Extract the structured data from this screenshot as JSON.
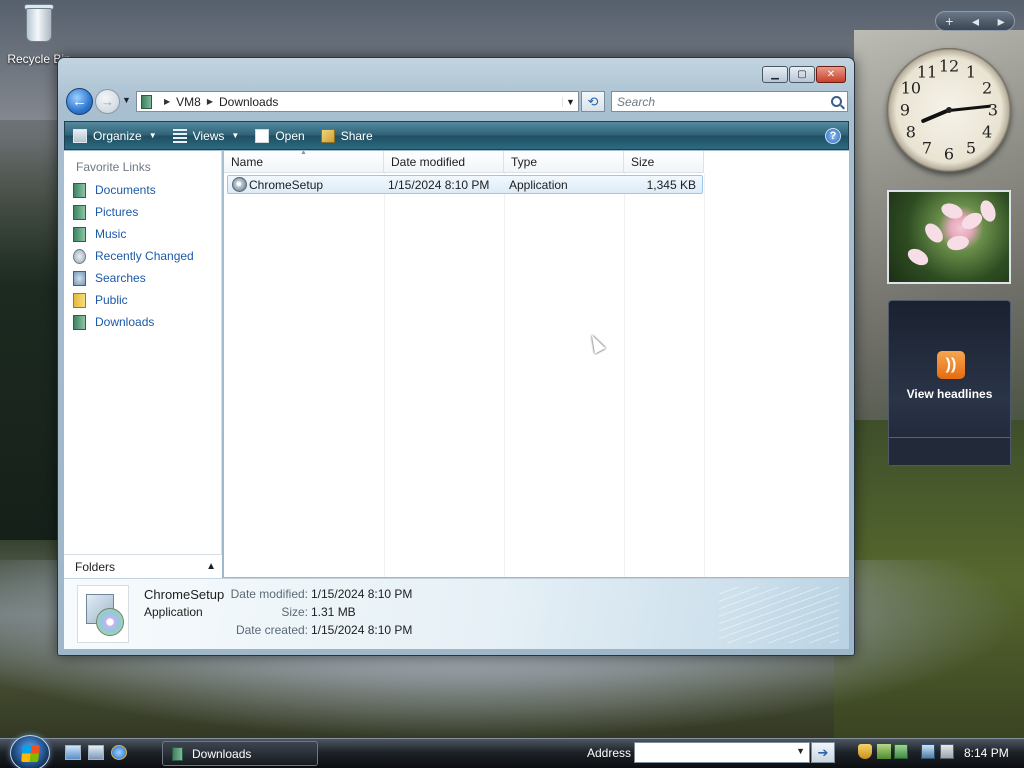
{
  "desktop": {
    "icons": [
      {
        "label": "Recycle Bin",
        "icon": "recycle-bin-icon"
      }
    ],
    "gadgets": {
      "controls": {
        "add": "+",
        "prev": "◂",
        "next": "▸"
      },
      "clock_numbers": [
        "12",
        "1",
        "2",
        "3",
        "4",
        "5",
        "6",
        "7",
        "8",
        "9",
        "10",
        "11"
      ],
      "clock_time": "8:14",
      "feed_label": "View headlines"
    }
  },
  "window": {
    "breadcrumb": [
      "VM8",
      "Downloads"
    ],
    "search_placeholder": "Search",
    "toolbar": {
      "organize": "Organize",
      "views": "Views",
      "open": "Open",
      "share": "Share"
    },
    "nav_pane": {
      "header": "Favorite Links",
      "links": [
        {
          "label": "Documents",
          "icon": "documents-icon"
        },
        {
          "label": "Pictures",
          "icon": "pictures-icon"
        },
        {
          "label": "Music",
          "icon": "music-icon"
        },
        {
          "label": "Recently Changed",
          "icon": "recently-changed-icon"
        },
        {
          "label": "Searches",
          "icon": "searches-icon"
        },
        {
          "label": "Public",
          "icon": "public-folder-icon"
        },
        {
          "label": "Downloads",
          "icon": "downloads-icon"
        }
      ],
      "folders_label": "Folders"
    },
    "columns": [
      "Name",
      "Date modified",
      "Type",
      "Size"
    ],
    "files": [
      {
        "name": "ChromeSetup",
        "date_modified": "1/15/2024 8:10 PM",
        "type": "Application",
        "size": "1,345 KB"
      }
    ],
    "details": {
      "name": "ChromeSetup",
      "kind": "Application",
      "date_modified_label": "Date modified:",
      "date_modified": "1/15/2024 8:10 PM",
      "size_label": "Size:",
      "size": "1.31 MB",
      "date_created_label": "Date created:",
      "date_created": "1/15/2024 8:10 PM"
    }
  },
  "taskbar": {
    "task_button": "Downloads",
    "address_label": "Address",
    "time": "8:14 PM"
  },
  "colors": {
    "toolbar": "#2f6276",
    "link": "#1a5aa8",
    "selection_border": "#9cc7eb"
  }
}
